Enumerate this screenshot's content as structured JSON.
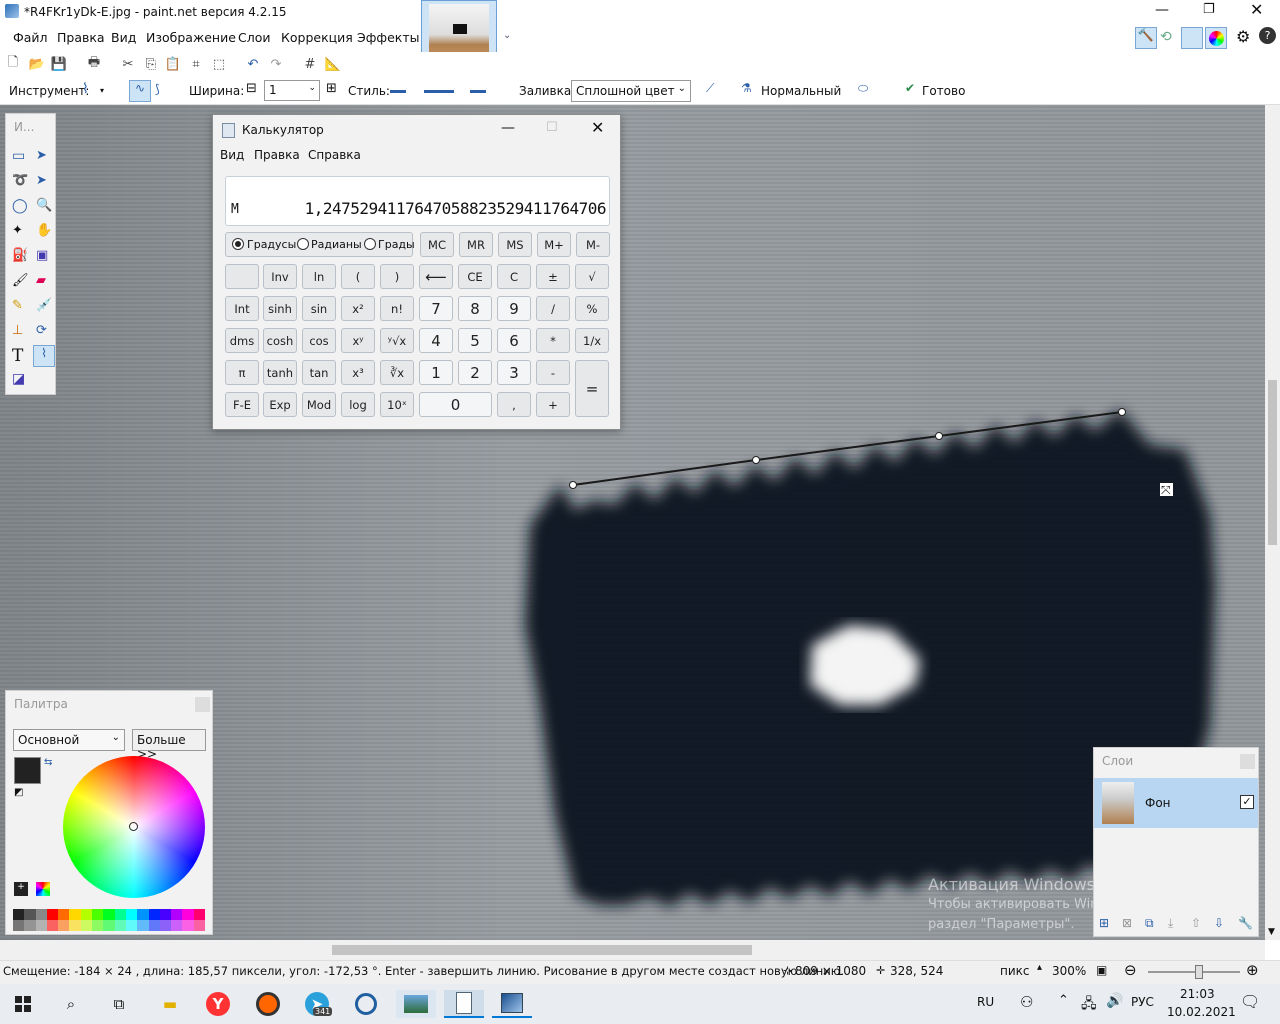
{
  "window": {
    "title": "*R4FKr1yDk-E.jpg - paint.net версия 4.2.15"
  },
  "menu": [
    "Файл",
    "Правка",
    "Вид",
    "Изображение",
    "Слои",
    "Коррекция",
    "Эффекты"
  ],
  "toolopts": {
    "tool_label": "Инструмент:",
    "width_label": "Ширина:",
    "width_value": "1",
    "style_label": "Стиль:",
    "fill_label": "Заливка:",
    "fill_value": "Сплошной цвет",
    "blend_value": "Нормальный",
    "done_label": "Готово"
  },
  "tools_panel": {
    "title": "И..."
  },
  "calculator": {
    "title": "Калькулятор",
    "menu": [
      "Вид",
      "Правка",
      "Справка"
    ],
    "memory_indicator": "M",
    "display": "1,24752941176470588235294117647 06",
    "display_value": "1,2475294117647058823529411764706",
    "angle_modes": [
      "Градусы",
      "Радианы",
      "Грады"
    ],
    "angle_selected": "Градусы",
    "mem_buttons": [
      "MC",
      "MR",
      "MS",
      "M+",
      "M-"
    ],
    "rows": [
      [
        "",
        "Inv",
        "ln",
        "(",
        ")",
        "⟵",
        "CE",
        "C",
        "±",
        "√"
      ],
      [
        "Int",
        "sinh",
        "sin",
        "x²",
        "n!",
        "7",
        "8",
        "9",
        "/",
        "%"
      ],
      [
        "dms",
        "cosh",
        "cos",
        "xʸ",
        "ʸ√x",
        "4",
        "5",
        "6",
        "*",
        "1/x"
      ],
      [
        "π",
        "tanh",
        "tan",
        "x³",
        "∛x",
        "1",
        "2",
        "3",
        "-",
        "="
      ],
      [
        "F-E",
        "Exp",
        "Mod",
        "log",
        "10ˣ",
        "0",
        ",",
        "+"
      ]
    ]
  },
  "palette": {
    "title": "Палитра",
    "mode": "Основной",
    "more_button": "Больше >>",
    "primary_color": "#222222",
    "secondary_color": "#eeeeee",
    "swatches": [
      "#222222",
      "#555555",
      "#888888",
      "#ff0000",
      "#ff6a00",
      "#ffd800",
      "#b6ff00",
      "#4cff00",
      "#00ff21",
      "#00ff90",
      "#00ffff",
      "#0094ff",
      "#0026ff",
      "#4800ff",
      "#b200ff",
      "#ff00dc",
      "#ff006e"
    ]
  },
  "layers": {
    "title": "Слои",
    "items": [
      {
        "name": "Фон",
        "visible": true
      }
    ]
  },
  "watermark": {
    "line1": "Активация Windows",
    "line2": "Чтобы активировать Windows, перейдите в",
    "line3": "раздел \"Параметры\"."
  },
  "status": {
    "message": "Смещение: -184 × 24 , длина: 185,57 пиксели, угол: -172,53 °. Enter - завершить линию. Рисование в другом месте создаст новую линию.",
    "size": "809 × 1080",
    "cursor": "328, 524",
    "unit": "пикс",
    "zoom": "300%"
  },
  "taskbar": {
    "lang": "РУС",
    "keyboard": "RU",
    "time": "21:03",
    "date": "10.02.2021",
    "telegram_badge": "341"
  },
  "colors": {
    "accent": "#0078d7",
    "canvas_object": "#0f1620"
  }
}
